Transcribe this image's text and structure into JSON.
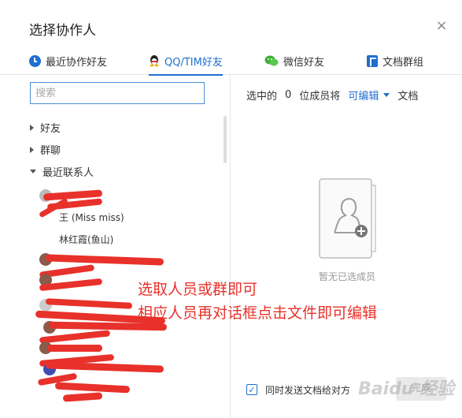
{
  "dialog": {
    "title": "选择协作人",
    "close_glyph": "×"
  },
  "tabs": [
    {
      "label": "最近协作好友",
      "icon": "clock-icon"
    },
    {
      "label": "QQ/TIM好友",
      "icon": "qq-penguin-icon",
      "active": true
    },
    {
      "label": "微信好友",
      "icon": "wechat-icon"
    },
    {
      "label": "文档群组",
      "icon": "doc-group-icon"
    }
  ],
  "search": {
    "placeholder": "搜索"
  },
  "groups": {
    "friends": "好友",
    "chats": "群聊",
    "recent": "最近联系人"
  },
  "contacts": {
    "c1": "王 (Miss miss)",
    "c2": "林红霞(鱼山)"
  },
  "selection": {
    "prefix": "选中的",
    "count": "0",
    "suffix": "位成员将",
    "permission": "可编辑",
    "target": "文档"
  },
  "empty_state": {
    "text": "暂无已选成员"
  },
  "annotation": {
    "line1": "选取人员或群即可",
    "line2": "相应人员再对话框点击文件即可编辑"
  },
  "footer": {
    "checkbox_label": "同时发送文档给对方",
    "done_label": "完成",
    "checked": true
  },
  "watermark": "Baidu 经验",
  "colors": {
    "accent": "#1e6fd0",
    "annotation": "#e8312a"
  }
}
